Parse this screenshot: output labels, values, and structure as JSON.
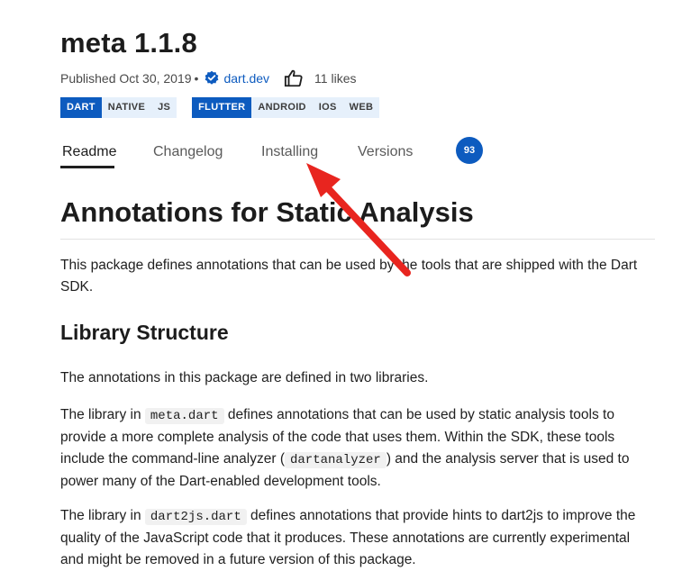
{
  "package": {
    "title": "meta 1.1.8",
    "published": "Published Oct 30, 2019",
    "separator": "•",
    "publisher": "dart.dev",
    "likes": "11 likes"
  },
  "tags": {
    "dart": [
      "DART",
      "NATIVE",
      "JS"
    ],
    "flutter": [
      "FLUTTER",
      "ANDROID",
      "IOS",
      "WEB"
    ]
  },
  "tabs": {
    "readme": "Readme",
    "changelog": "Changelog",
    "installing": "Installing",
    "versions": "Versions",
    "score": "93"
  },
  "content": {
    "heading": "Annotations for Static Analysis",
    "intro": "This package defines annotations that can be used by the tools that are shipped with the Dart SDK.",
    "structure_heading": "Library Structure",
    "p1": "The annotations in this package are defined in two libraries.",
    "p2_before": "The library in ",
    "p2_code": "meta.dart",
    "p2_mid": " defines annotations that can be used by static analysis tools to provide a more complete analysis of the code that uses them. Within the SDK, these tools include the command-line analyzer (",
    "p2_code2": "dartanalyzer",
    "p2_after": ") and the analysis server that is used to power many of the Dart-enabled development tools.",
    "p3_before": "The library in ",
    "p3_code": "dart2js.dart",
    "p3_after": " defines annotations that provide hints to dart2js to improve the quality of the JavaScript code that it produces. These annotations are currently experimental and might be removed in a future version of this package."
  },
  "icons": {
    "verified": "verified-badge-icon",
    "like": "thumbs-up-icon",
    "annotation": "red-arrow-icon"
  },
  "colors": {
    "accent": "#0d5bbf",
    "tag_bg": "#e6f0fb",
    "arrow": "#e8251f"
  }
}
